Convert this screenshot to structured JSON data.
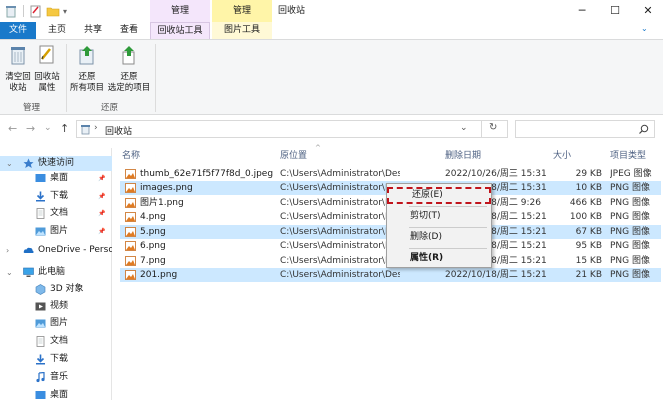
{
  "window": {
    "title": "回收站",
    "context_header_manage_1": "管理",
    "context_header_manage_2": "管理",
    "minimize": "─",
    "maximize": "☐",
    "close": "✕"
  },
  "tabs": {
    "file": "文件",
    "main": "主页",
    "share": "共享",
    "view": "查看",
    "recycle_tools": "回收站工具",
    "picture_tools": "图片工具",
    "expand": "⌄"
  },
  "ribbon": {
    "empty_recycle": [
      "清空回",
      "收站"
    ],
    "recycle_props": [
      "回收站",
      "属性"
    ],
    "restore_all": [
      "还原",
      "所有项目"
    ],
    "restore_selected": [
      "还原",
      "选定的项目"
    ],
    "group_manage": "管理",
    "group_restore": "还原"
  },
  "address": {
    "back": "←",
    "forward": "→",
    "recent": "⌄",
    "up": "↑",
    "sep": "›",
    "path": "回收站",
    "dropdown": "⌄",
    "refresh": "↻",
    "search_placeholder": ""
  },
  "nav_pane": {
    "items": [
      {
        "label": "快速访问",
        "icon": "star-icon"
      },
      {
        "label": "桌面",
        "icon": "desktop-folder-icon",
        "pinned": true
      },
      {
        "label": "下载",
        "icon": "download-folder-icon",
        "pinned": true
      },
      {
        "label": "文档",
        "icon": "documents-folder-icon",
        "pinned": true
      },
      {
        "label": "图片",
        "icon": "pictures-folder-icon",
        "pinned": true
      },
      {
        "label": "OneDrive - Persona",
        "icon": "onedrive-cloud-icon"
      },
      {
        "label": "此电脑",
        "icon": "pc-icon"
      },
      {
        "label": "3D 对象",
        "icon": "3d-objects-icon"
      },
      {
        "label": "视频",
        "icon": "videos-folder-icon"
      },
      {
        "label": "图片",
        "icon": "pictures-folder-icon"
      },
      {
        "label": "文档",
        "icon": "documents-folder-icon"
      },
      {
        "label": "下载",
        "icon": "download-folder-icon"
      },
      {
        "label": "音乐",
        "icon": "music-folder-icon"
      },
      {
        "label": "桌面",
        "icon": "desktop-folder-icon"
      }
    ],
    "pin_glyph": "📌"
  },
  "list": {
    "headers": {
      "name": "名称",
      "path": "原位置",
      "date": "删除日期",
      "size": "大小",
      "type": "项目类型"
    },
    "rows": [
      {
        "name": "thumb_62e71f5f77f8d_0.jpeg",
        "path": "C:\\Users\\Administrator\\Desktop",
        "date": "2022/10/26/周三 15:31",
        "size": "29 KB",
        "type": "JPEG 图像"
      },
      {
        "name": "images.png",
        "path": "C:\\Users\\Administrator\\Desk",
        "date": "2022/10/18/周二 15:31",
        "size": "10 KB",
        "type": "PNG 图像"
      },
      {
        "name": "图片1.png",
        "path": "C:\\Users\\Administrator\\Desk",
        "date": "2022/10/18/周二 9:26",
        "size": "466 KB",
        "type": "PNG 图像"
      },
      {
        "name": "4.png",
        "path": "C:\\Users\\Administrator\\Desk",
        "date": "2022/10/18/周二 15:21",
        "size": "100 KB",
        "type": "PNG 图像"
      },
      {
        "name": "5.png",
        "path": "C:\\Users\\Administrator\\Desk",
        "date": "2022/10/18/周二 15:21",
        "size": "67 KB",
        "type": "PNG 图像"
      },
      {
        "name": "6.png",
        "path": "C:\\Users\\Administrator\\Desk",
        "date": "2022/10/18/周二 15:21",
        "size": "95 KB",
        "type": "PNG 图像"
      },
      {
        "name": "7.png",
        "path": "C:\\Users\\Administrator\\Desk",
        "date": "2022/10/18/周二 15:21",
        "size": "15 KB",
        "type": "PNG 图像"
      },
      {
        "name": "201.png",
        "path": "C:\\Users\\Administrator\\Desktop",
        "date": "2022/10/18/周二 15:21",
        "size": "21 KB",
        "type": "PNG 图像"
      }
    ]
  },
  "context_menu": {
    "restore": "还原(E)",
    "cut": "剪切(T)",
    "delete": "删除(D)",
    "properties": "属性(R)"
  },
  "colors": {
    "accent": "#1979ca",
    "selection": "#cce8ff",
    "highlight": "#c0141c"
  }
}
